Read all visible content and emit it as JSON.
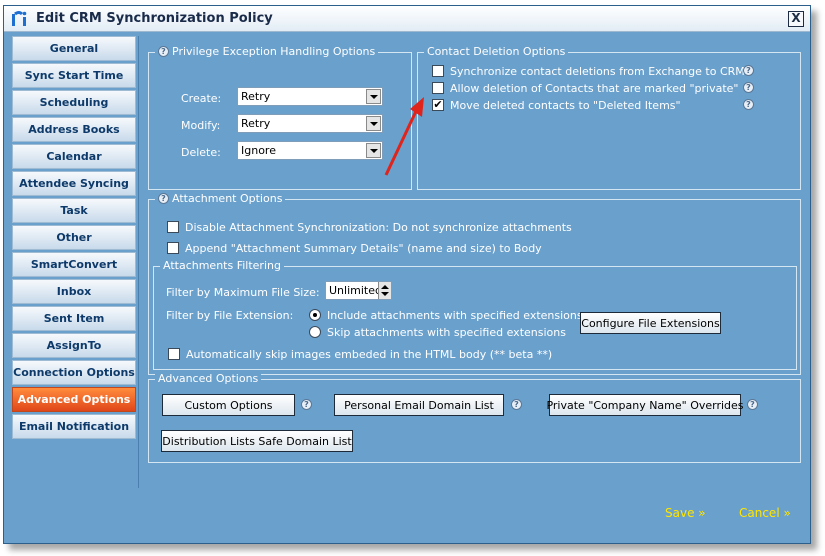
{
  "window": {
    "title": "Edit CRM Synchronization Policy",
    "close_label": "X"
  },
  "sidebar": {
    "items": [
      {
        "label": "General"
      },
      {
        "label": "Sync Start Time"
      },
      {
        "label": "Scheduling"
      },
      {
        "label": "Address Books"
      },
      {
        "label": "Calendar"
      },
      {
        "label": "Attendee Syncing"
      },
      {
        "label": "Task"
      },
      {
        "label": "Other"
      },
      {
        "label": "SmartConvert"
      },
      {
        "label": "Inbox"
      },
      {
        "label": "Sent Item"
      },
      {
        "label": "AssignTo"
      },
      {
        "label": "Connection Options"
      },
      {
        "label": "Advanced Options",
        "active": true
      },
      {
        "label": "Email Notification"
      }
    ]
  },
  "privilege": {
    "legend": "Privilege Exception Handling Options",
    "create_label": "Create:",
    "create_value": "Retry",
    "modify_label": "Modify:",
    "modify_value": "Retry",
    "delete_label": "Delete:",
    "delete_value": "Ignore"
  },
  "contact_deletion": {
    "legend": "Contact Deletion Options",
    "options": [
      {
        "label": "Synchronize contact deletions from Exchange to CRM",
        "checked": false
      },
      {
        "label": "Allow deletion of Contacts that are marked \"private\"",
        "checked": false
      },
      {
        "label": "Move deleted contacts to \"Deleted Items\"",
        "checked": true
      }
    ]
  },
  "attachment": {
    "legend": "Attachment Options",
    "disable_label": "Disable Attachment Synchronization: Do not synchronize attachments",
    "append_label": "Append \"Attachment Summary Details\" (name and size) to Body",
    "filtering": {
      "legend": "Attachments Filtering",
      "max_size_label": "Filter by Maximum File Size:",
      "max_size_value": "Unlimited",
      "ext_label": "Filter by File Extension:",
      "include_label": "Include attachments with specified extensions",
      "skip_label": "Skip attachments with specified extensions",
      "configure_button": "Configure File Extensions",
      "skip_images_label": "Automatically skip images embeded in the HTML body (** beta **)"
    }
  },
  "advanced": {
    "legend": "Advanced Options",
    "custom_button": "Custom Options",
    "personal_button": "Personal Email Domain List",
    "private_button": "Private \"Company Name\" Overrides",
    "distribution_button": "Distribution Lists Safe Domain List"
  },
  "footer": {
    "save_label": "Save »",
    "cancel_label": "Cancel »"
  },
  "icons": {
    "help": "?",
    "check": "✔"
  },
  "colors": {
    "window_bg": "#6aa0cc",
    "active_tab": "#f0621f",
    "footer_link": "#ffe600",
    "annotation_arrow": "#e0241c"
  }
}
